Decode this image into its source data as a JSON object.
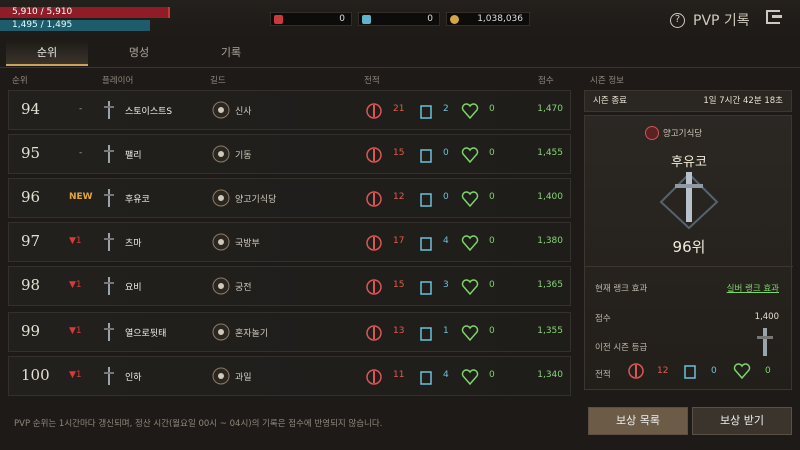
{
  "stats": {
    "hp": "5,910 / 5,910",
    "mp": "1,495 / 1,495"
  },
  "currencies": [
    {
      "value": "0",
      "color": "#c93b3b"
    },
    {
      "value": "0",
      "color": "#5fb4c9"
    },
    {
      "value": "1,038,036",
      "color": "#d3a544"
    }
  ],
  "header": {
    "title": "PVP 기록",
    "help": "?"
  },
  "tabs": [
    "순위",
    "명성",
    "기록"
  ],
  "columns": {
    "rank": "순위",
    "player": "플레이어",
    "guild": "길드",
    "record": "전적",
    "score": "점수",
    "season": "시즌 정보"
  },
  "rows": [
    {
      "rank": "94",
      "change": "-",
      "player": "스토이스트S",
      "guild": "신사",
      "kills": "21",
      "deaths": "2",
      "assists": "0",
      "score": "1,470"
    },
    {
      "rank": "95",
      "change": "-",
      "player": "팰리",
      "guild": "기동",
      "kills": "15",
      "deaths": "0",
      "assists": "0",
      "score": "1,455"
    },
    {
      "rank": "96",
      "change": "NEW",
      "player": "후유코",
      "guild": "양고기식당",
      "kills": "12",
      "deaths": "0",
      "assists": "0",
      "score": "1,400"
    },
    {
      "rank": "97",
      "change": "1",
      "player": "츠마",
      "guild": "국방부",
      "kills": "17",
      "deaths": "4",
      "assists": "0",
      "score": "1,380"
    },
    {
      "rank": "98",
      "change": "1",
      "player": "요비",
      "guild": "궁전",
      "kills": "15",
      "deaths": "3",
      "assists": "0",
      "score": "1,365"
    },
    {
      "rank": "99",
      "change": "1",
      "player": "열으로뒷태",
      "guild": "혼자놀기",
      "kills": "13",
      "deaths": "1",
      "assists": "0",
      "score": "1,355"
    },
    {
      "rank": "100",
      "change": "1",
      "player": "인하",
      "guild": "과일",
      "kills": "11",
      "deaths": "4",
      "assists": "0",
      "score": "1,340"
    }
  ],
  "season": {
    "label": "시즌 종료",
    "time": "1일 7시간 42분 18초"
  },
  "profile": {
    "guild": "양고기식당",
    "name": "후유코",
    "rank": "96위",
    "effect_label": "현재 랭크 효과",
    "effect_value": "실버 랭크 효과",
    "score_label": "점수",
    "score_value": "1,400",
    "prev_label": "이전 시즌 등급",
    "record_label": "전적",
    "kills": "12",
    "deaths": "0",
    "assists": "0"
  },
  "buttons": {
    "rewards_list": "보상 목록",
    "claim": "보상 받기"
  },
  "footer": "PVP 순위는 1시간마다 갱신되며, 정산 시간(월요일 00시 ~ 04시)의 기록은 점수에 반영되지 않습니다."
}
